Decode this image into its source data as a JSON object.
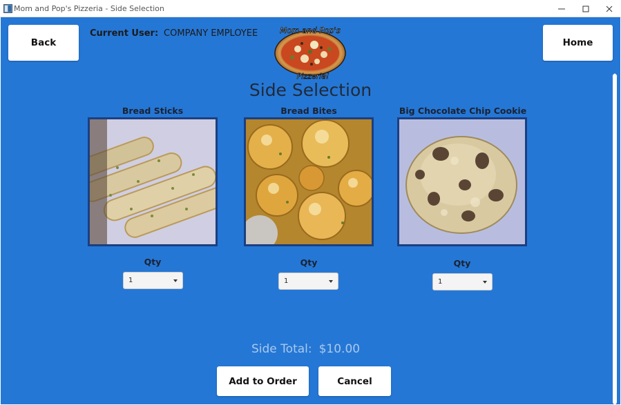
{
  "window": {
    "title": "Mom and Pop's Pizzeria - Side Selection",
    "controls": [
      "minimize",
      "maximize",
      "close"
    ]
  },
  "header": {
    "back_label": "Back",
    "home_label": "Home",
    "current_user_label": "Current User:",
    "current_user_value": "COMPANY EMPLOYEE",
    "logo": {
      "top_text": "Mom and Pop's",
      "bottom_text": "Pizzeria!"
    }
  },
  "page_title": "Side Selection",
  "items": [
    {
      "name": "Bread Sticks",
      "image": "bread-sticks-photo",
      "qty_label": "Qty",
      "qty_value": "1"
    },
    {
      "name": "Bread Bites",
      "image": "bread-bites-photo",
      "qty_label": "Qty",
      "qty_value": "1"
    },
    {
      "name": "Big Chocolate Chip Cookie",
      "image": "cookie-photo",
      "qty_label": "Qty",
      "qty_value": "1"
    }
  ],
  "footer": {
    "side_total_label": "Side Total:",
    "side_total_value": "$10.00",
    "add_label": "Add to Order",
    "cancel_label": "Cancel"
  },
  "colors": {
    "background": "#2577d5",
    "button": "#ffffff",
    "image_border": "#1b3f80",
    "total_text": "#a9c9ee"
  }
}
